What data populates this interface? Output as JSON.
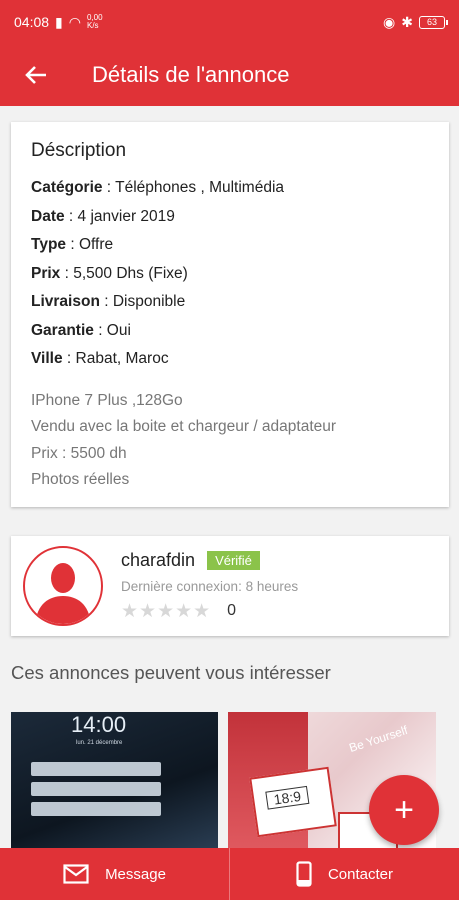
{
  "status": {
    "time": "04:08",
    "speed_value": "0,00",
    "speed_unit": "K/s",
    "battery": "63"
  },
  "toolbar": {
    "title": "Détails de l'annonce"
  },
  "description": {
    "title": "Déscription",
    "fields": [
      {
        "label": "Catégorie",
        "value": " : Téléphones , Multimédia"
      },
      {
        "label": "Date",
        "value": " : 4 janvier 2019"
      },
      {
        "label": "Type",
        "value": " : Offre"
      },
      {
        "label": "Prix",
        "value": " : 5,500 Dhs (Fixe)"
      },
      {
        "label": "Livraison",
        "value": " : Disponible"
      },
      {
        "label": "Garantie",
        "value": " : Oui"
      },
      {
        "label": "Ville",
        "value": " : Rabat, Maroc"
      }
    ],
    "text_lines": [
      "IPhone 7 Plus ,128Go",
      "Vendu avec la boite et chargeur / adaptateur",
      "Prix : 5500 dh",
      "Photos réelles"
    ]
  },
  "seller": {
    "name": "charafdin",
    "badge": "Vérifié",
    "last_seen": "Dernière connexion: 8 heures",
    "rating_count": "0",
    "rating_value": 0,
    "rating_max": 5
  },
  "suggestions": {
    "title": "Ces annonces peuvent vous intéresser",
    "thumb1_time": "14:00",
    "thumb1_date": "lun. 21 décembre",
    "thumb2_slogan": "Be Yourself",
    "thumb2_ratio": "18:9"
  },
  "fab": {
    "icon": "plus-icon"
  },
  "bottom": {
    "message_label": "Message",
    "contact_label": "Contacter"
  },
  "colors": {
    "primary": "#e03237",
    "verified": "#8bc34a"
  }
}
